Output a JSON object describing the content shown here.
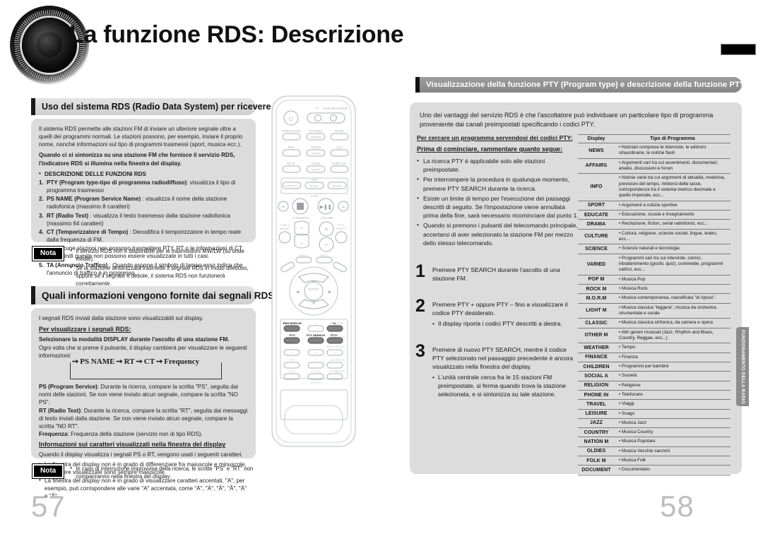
{
  "document": {
    "title": "La funzione RDS: Descrizione",
    "page_left": "57",
    "page_right": "58",
    "side_tab": "FUNZIONAMENTO DELLA RADIO"
  },
  "left": {
    "section1_heading": "Uso del sistema RDS (Radio Data System) per ricevere le stazioni FM",
    "intro": "Il sistema RDS permette alle stazioni FM di inviare un ulteriore segnale oltre a quelli dei programmi normali. Le stazioni possono, per esempio, inviare il proprio nome, nonché informazioni sul tipo di programmi trasmessi (sport, musica ecc.).",
    "bold_note": "Quando ci si sintonizza su una stazione FM che fornisce il servizio RDS, l'indicatore RDS si illumina nella finestra del display.",
    "functions_heading": "DESCRIZIONE DELLE FUNZIONI RDS",
    "functions": [
      {
        "bold": "PTY (Program type-tipo di programma radiodiffuso)",
        "rest": ": visualizza il tipo di programma trasmesso"
      },
      {
        "bold": "PS NAME (Program Service Name)",
        "rest": " : visualizza il nome della stazione radiofonica (massimo 8 caratteri)"
      },
      {
        "bold": "RT (Radio Text)",
        "rest": " : visualizza il testo trasmesso dalla stazione radiofonica (massimo 64 caratteri)"
      },
      {
        "bold": "CT (Temporizzatore di Tempo)",
        "rest": " : Decodifica il temporizzatore in tempo reale dalla frequenza di FM."
      },
      {
        "bold": "TA (Annuncio Traffico)",
        "rest": " : Quando espone il simbolo di lampo esso indica che l'annuncio di traffico è in progresso."
      }
    ],
    "ct_subnote": "Alcune stazioni non possono trasmettere PTY, RT o le informazioni di CT quindi queste non possono essere visualizzate in tutti i casi.",
    "note1_tag": "Nota",
    "note1_items": [
      "Il servizio RDS non è disponibile per le trasmissioni MW/LW (su onde medie).",
      "Se la stazione sintonizzata trasmette il segnale RDS in modo difettoso, oppure se il segnale è debole, il sistema RDS non funzionerà correttamente."
    ],
    "section2_heading": "Quali informazioni vengono fornite dai segnali RDS?",
    "s2_intro": "I segnali RDS inviati dalla stazione sono visualizzabili sul display.",
    "s2_sub1": "Per visualizzare i segnali RDS:",
    "s2_bold1": "Selezionare la modalità DISPLAY durante l'ascolto di una stazione FM.",
    "s2_text1": "Ogni volta che si preme il pulsante,  il display cambierà per visualizzare le seguenti informazioni:",
    "flow": [
      "PS NAME",
      "RT",
      "CT",
      "Frequency"
    ],
    "ps_bold": "PS (Program Service)",
    "ps_rest": ": Durante la ricerca, compare la scritta \"PS\", seguita dai nomi delle stazioni. Se non viene inviato alcun segnale, compare la scritta \"NO PS\".",
    "rt_bold": "RT (Radio Text)",
    "rt_rest": ": Durante la ricerca, compare la scritta \"RT\", seguita dai messaggi di testo inviati dalla stazione. Se non viene inviato alcun segnale, compare la scritta \"NO RT\".",
    "freq_bold": "Frequenza",
    "freq_rest": ": Frequenza della stazione (servizio non di tipo RDS).",
    "s2_sub2": "Informazioni sui caratteri visualizzati nella finestra del display",
    "s2_text2": "Quando il display visualizza i segnali PS o RT, vengono usati i seguenti caratteri.",
    "char_items": [
      "La finestra del display non è in grado di differenziare fra maiuscole e minuscole, e le lettere visualizzate sono sempre maiuscole.",
      "La finestra del display non è in grado di visualizzare caratteri accentati, \"A\", per esempio, può corrispondere alle varie \"A\" accentata, come \"À\", \"Á\", \"Â\", \"Ã\", \"Ä\" e \"Å\"."
    ],
    "note2_tag": "Nota",
    "note2_items": [
      "In caso di interruzione improvvisa della ricerca, le scritte \"PS\" e \"RT\" non compariranno nella finestra del display."
    ]
  },
  "remote": {
    "labels": {
      "tv": "TV",
      "dvd": "DVD RECEIVER",
      "open_close": "OPEN/CLOSE",
      "tv_video": "TV/VIDEO",
      "dimmer": "DIMMER",
      "mode": "MODE",
      "dvd_btn": "DVD",
      "tuner": "TUNER",
      "band": "BAND",
      "aux": "AUX",
      "mute": "MUTE",
      "slow": "SLOW",
      "mo_st": "MO/ST",
      "subtitle": "SUBTITLE",
      "dsp": "DSP",
      "superb": "SUPER 5.1",
      "music": "MUSIC",
      "movie": "MOVIE",
      "vsm": "V-HSP",
      "tuning": "TUNING/CH",
      "volume": "VOLUME",
      "ctrl": "CTRL/II MODE",
      "ply_effect": "P.L II EFFECT",
      "menu": "MENU",
      "info": "INFO",
      "enter": "ENTER",
      "rds_display": "RDS DISPLAY",
      "ta": "TA",
      "pty_minus": "PTY-",
      "pty_search": "PTY SEARCH",
      "pty_plus": "PTY+",
      "test_tone": "TEST TONE",
      "sound_edit": "SOUND EDIT",
      "tuner_memory": "TUNER MEMORY",
      "step": "STEP",
      "cancel": "CANCEL",
      "zoom": "ZOOM",
      "logo": "LOGO",
      "p_scan": "P.SCAN",
      "repeat": "REPEAT",
      "return": "RETURN",
      "special": "SPECIAL"
    },
    "highlighted": [
      "RDS DISPLAY",
      "TA",
      "PTY-",
      "PTY SEARCH",
      "PTY+"
    ]
  },
  "right": {
    "section_heading": "Visualizzazione della funzione PTY (Program type) e descrizione della funzione PTY-SEARCH",
    "intro": "Uno dei vantaggi del servizio RDS è che l'ascoltatore può individuare un particolare tipo di programma proveniente dai canali preimpostati specificando i codici PTY.",
    "sub1": "Per cercare un programma servendosi dei codici PTY:",
    "sub2": "Prima di cominciare, rammentare quanto segue:",
    "bullets": [
      "La ricerca PTY è applicabile solo alle stazioni preimpostate.",
      "Per interrompere la procedura in qualunque momento, premere PTY SEARCH durante la ricerca.",
      "Esiste un limite di tempo per l'esecuzione dei passaggi descritti di seguito. Se l'impostazione viene annullata prima della fine, sarà necessario ricominciare dal punto 1.",
      "Quando si premono i pulsanti del telecomando principale, accertarsi di aver selezionato la stazione FM per mezzo dello stesso telecomando."
    ],
    "steps": [
      {
        "num": "1",
        "text": "Premere PTY SEARCH durante l'ascolto di una stazione FM.",
        "sub": ""
      },
      {
        "num": "2",
        "text": "Premere PTY + oppure PTY – fino a visualizzare il codice PTY desiderato.",
        "sub": "Il display riporta i codici PTY descritti a destra."
      },
      {
        "num": "3",
        "text": "Premere di nuovo PTY SEARCH, mentre il codice PTY selezionato nel passaggio precedente è ancora visualizzato nella finestra del display.",
        "sub": "L'unità centrale cerca fra le 15 stazioni FM preimpostate, si ferma quando trova la stazione selezionata, e si sintonizza su tale stazione."
      }
    ],
    "table": {
      "headers": [
        "Display",
        "Tipo di Programma"
      ],
      "rows": [
        [
          "NEWS",
          "Notiziari comprese le interviste, le edizioni straordinarie, le notizie flash"
        ],
        [
          "AFFAIRS",
          "Argomenti vari tra cui avvenimenti, documentari, analisi, discussioni e forum"
        ],
        [
          "INFO",
          "Notizie varie tra cui argomenti di attualità, medicina, previsioni del tempo, rimborsi delle tasse, corrispondenza tra il sistema  metrico decimale e quello imperiale, ecc..."
        ],
        [
          "SPORT",
          "Argomenti e notizie sportive"
        ],
        [
          "EDUCATE",
          "Educazione, scuola e insegnamento"
        ],
        [
          "DRAMA",
          "Recitazione, fiction, serial radiofonici, ecc..."
        ],
        [
          "CULTURE",
          "Cultura, religione, scienze sociali, lingue, teatro, ecc..."
        ],
        [
          "SCIENCE",
          "Scienze naturali e tecnologia"
        ],
        [
          "VARIED",
          "Programmi vari tra cui interviste, comici, intrattenimento (giochi, quiz), commedie, programmi satirici, ecc..."
        ],
        [
          "POP M",
          "Musica Pop"
        ],
        [
          "ROCK M",
          "Musica Rock"
        ],
        [
          "M.O.R.M",
          "Musica contemporanea, classificata \"di riposo\"."
        ],
        [
          "LIGHT M",
          "Musica classica \"leggera\", musica da orchestra, strumentale e corale"
        ],
        [
          "CLASSIC",
          "Musica classica sinfonica, da camera e opera"
        ],
        [
          "OTHER M",
          "Altri generi musicali (Jazz, Rhythm and Blues, Country, Reggae, ecc...)"
        ],
        [
          "WEATHER",
          "Tempo"
        ],
        [
          "FINANCE",
          "Finanza"
        ],
        [
          "CHILDREN",
          "Programmi per bambini"
        ],
        [
          "SOCIAL A",
          "Società"
        ],
        [
          "RELIGION",
          "Religione"
        ],
        [
          "PHONE IN",
          "Telefonare"
        ],
        [
          "TRAVEL",
          "Viaggi"
        ],
        [
          "LEISURE",
          "Svago"
        ],
        [
          "JAZZ",
          "Musica Jazz"
        ],
        [
          "COUNTRY",
          "Musica Country"
        ],
        [
          "NATION M",
          "Musica Popolare"
        ],
        [
          "OLDIES",
          "Musica Vecchie canzoni"
        ],
        [
          "FOLK M",
          "Musica Folk"
        ],
        [
          "DOCUMENT",
          "Documentario"
        ]
      ]
    }
  },
  "colors": {
    "panel_bg": "#dcdcdc",
    "bar_light": "#d8d8d8",
    "bar_dark": "#8f8f8f",
    "folio": "#bdbdbd",
    "ink": "#1a1a1a"
  }
}
